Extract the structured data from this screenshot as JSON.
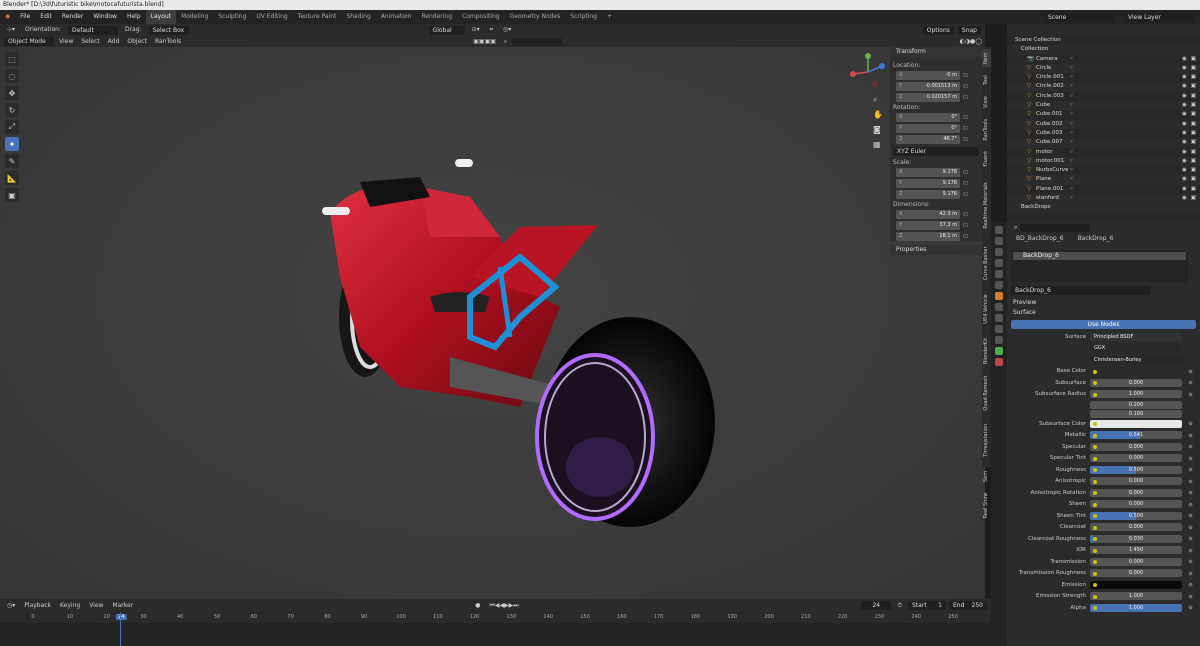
{
  "window": {
    "title": "Blender* [D:\\3d\\futuristic bike\\motocafuturista.blend]"
  },
  "menus": [
    "File",
    "Edit",
    "Render",
    "Window",
    "Help"
  ],
  "workspaces": [
    "Layout",
    "Modeling",
    "Sculpting",
    "UV Editing",
    "Texture Paint",
    "Shading",
    "Animation",
    "Rendering",
    "Compositing",
    "Geometry Nodes",
    "Scripting",
    "+"
  ],
  "active_workspace": "Layout",
  "top_right": {
    "scene": "Scene",
    "view_layer": "View Layer"
  },
  "header": {
    "orientation_label": "Orientation:",
    "orientation": "Default",
    "drag_label": "Drag:",
    "drag": "Select Box",
    "transform_orientation": "Global",
    "options": "Options",
    "snap": "Snap"
  },
  "header2": {
    "mode": "Object Mode",
    "items": [
      "View",
      "Select",
      "Add",
      "Object",
      "RanTools"
    ]
  },
  "npanel": {
    "transform": "Transform",
    "location_label": "Location:",
    "location": [
      {
        "axis": "X",
        "value": "-0 m"
      },
      {
        "axis": "Y",
        "value": "-0.001513 m"
      },
      {
        "axis": "Z",
        "value": "0.020157 m"
      }
    ],
    "rotation_label": "Rotation:",
    "rotation": [
      {
        "axis": "X",
        "value": "0°"
      },
      {
        "axis": "Y",
        "value": "0°"
      },
      {
        "axis": "Z",
        "value": "46.7°"
      }
    ],
    "rotation_mode": "XYZ Euler",
    "scale_label": "Scale:",
    "scale": [
      {
        "axis": "X",
        "value": "9.176"
      },
      {
        "axis": "Y",
        "value": "9.176"
      },
      {
        "axis": "Z",
        "value": "9.176"
      }
    ],
    "dimensions_label": "Dimensions:",
    "dimensions": [
      {
        "axis": "X",
        "value": "42.3 m"
      },
      {
        "axis": "Y",
        "value": "37.3 m"
      },
      {
        "axis": "Z",
        "value": "18.1 m"
      }
    ],
    "properties": "Properties"
  },
  "vtabs": [
    "Item",
    "Tool",
    "View",
    "RanTools",
    "Fluent",
    "Realtime Materials",
    "Curve Basher",
    "UE4 Vehicle",
    "BlenderKit",
    "Quad Remesh",
    "Threejstation",
    "Sem",
    "Real Snow"
  ],
  "outliner": {
    "root": "Scene Collection",
    "collection": "Collection",
    "items": [
      "Camera",
      "Circle",
      "Circle.001",
      "Circle.002",
      "Circle.003",
      "Cube",
      "Cube.001",
      "Cube.002",
      "Cube.003",
      "Cube.007",
      "motor",
      "motor.001",
      "NurbsCurve",
      "Plane",
      "Plane.001",
      "stanford"
    ],
    "backdrops": "BackDrops"
  },
  "properties": {
    "search_placeholder": "",
    "object": "BD_BackDrop_6",
    "material_tab": "BackDrop_6",
    "slot": "BackDrop_6",
    "material": "BackDrop_6",
    "preview": "Preview",
    "surface_section": "Surface",
    "use_nodes": "Use Nodes",
    "surface_label": "Surface",
    "surface_value": "Principled BSDF",
    "distribution": "GGX",
    "subsurface_method": "Christensen-Burley",
    "rows": [
      {
        "label": "Base Color",
        "value": "",
        "type": "color",
        "color": "#2a2a2a"
      },
      {
        "label": "Subsurface",
        "value": "0.000",
        "fill": 0
      },
      {
        "label": "Subsurface Radius",
        "value": "1.000",
        "type": "vec",
        "extra": [
          "0.200",
          "0.100"
        ]
      },
      {
        "label": "Subsurface Color",
        "value": "",
        "type": "color",
        "color": "#e8e8e8"
      },
      {
        "label": "Metallic",
        "value": "0.541",
        "fill": 0.541
      },
      {
        "label": "Specular",
        "value": "0.000",
        "fill": 0
      },
      {
        "label": "Specular Tint",
        "value": "0.000",
        "fill": 0
      },
      {
        "label": "Roughness",
        "value": "0.500",
        "fill": 0.5
      },
      {
        "label": "Anisotropic",
        "value": "0.000",
        "fill": 0
      },
      {
        "label": "Anisotropic Rotation",
        "value": "0.000",
        "fill": 0
      },
      {
        "label": "Sheen",
        "value": "0.000",
        "fill": 0
      },
      {
        "label": "Sheen Tint",
        "value": "0.500",
        "fill": 0.5
      },
      {
        "label": "Clearcoat",
        "value": "0.000",
        "fill": 0
      },
      {
        "label": "Clearcoat Roughness",
        "value": "0.030",
        "fill": 0.03
      },
      {
        "label": "IOR",
        "value": "1.450",
        "fill": 0
      },
      {
        "label": "Transmission",
        "value": "0.000",
        "fill": 0
      },
      {
        "label": "Transmission Roughness",
        "value": "0.000",
        "fill": 0
      },
      {
        "label": "Emission",
        "value": "",
        "type": "color",
        "color": "#0a0a0a"
      },
      {
        "label": "Emission Strength",
        "value": "1.000",
        "fill": 0
      },
      {
        "label": "Alpha",
        "value": "1.000",
        "fill": 1
      }
    ]
  },
  "timeline": {
    "menus": [
      "Playback",
      "Keying",
      "View",
      "Marker"
    ],
    "current_frame": "24",
    "start_label": "Start",
    "start": "1",
    "end_label": "End",
    "end": "250",
    "ticks": [
      "0",
      "10",
      "20",
      "24",
      "30",
      "40",
      "50",
      "60",
      "70",
      "80",
      "90",
      "100",
      "110",
      "120",
      "130",
      "140",
      "150",
      "160",
      "170",
      "180",
      "190",
      "200",
      "210",
      "220",
      "230",
      "240",
      "250"
    ]
  },
  "colors": {
    "accent": "#4772b3",
    "bike_red": "#c8102e",
    "frame_blue": "#1f8fd6",
    "rim_glow": "#b36bff"
  }
}
